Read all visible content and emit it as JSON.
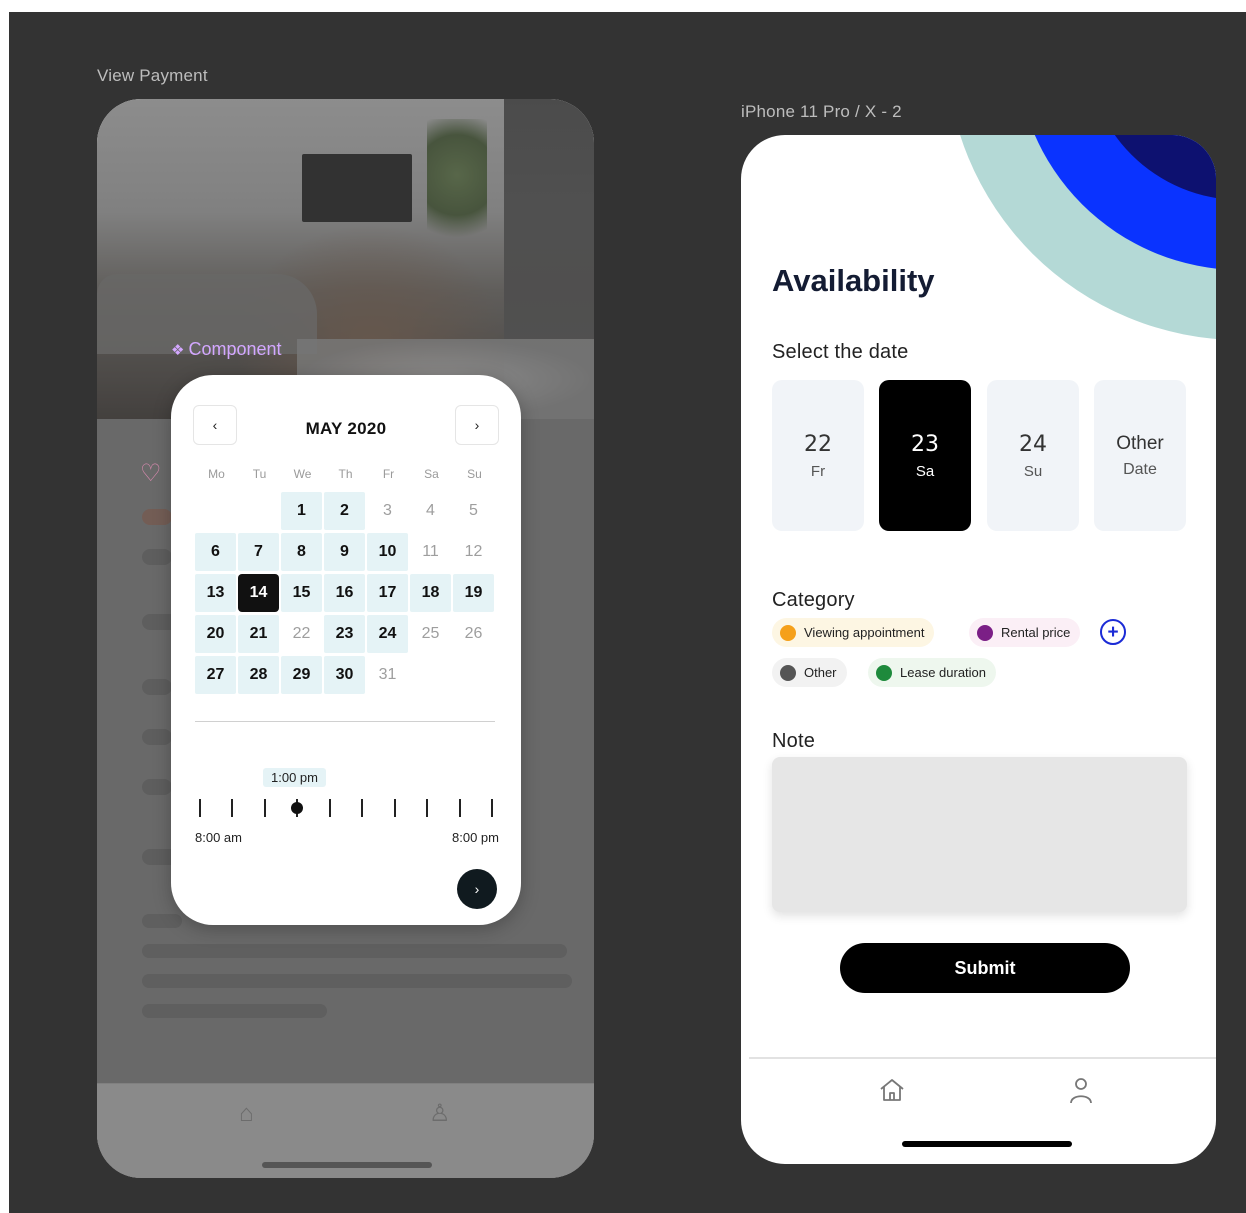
{
  "frames": {
    "left_label": "View Payment",
    "right_label": "iPhone 11 Pro / X - 2"
  },
  "component": {
    "label": "Component",
    "icon": "component-diamond-icon"
  },
  "calendar": {
    "month": "MAY 2020",
    "prev_label": "‹",
    "next_label": "›",
    "weekdays": [
      "Mo",
      "Tu",
      "We",
      "Th",
      "Fr",
      "Sa",
      "Su"
    ],
    "days": [
      {
        "label": "",
        "state": "empty"
      },
      {
        "label": "",
        "state": "empty"
      },
      {
        "label": "1",
        "state": "avail"
      },
      {
        "label": "2",
        "state": "avail"
      },
      {
        "label": "3",
        "state": "muted"
      },
      {
        "label": "4",
        "state": "muted"
      },
      {
        "label": "5",
        "state": "muted"
      },
      {
        "label": "6",
        "state": "avail"
      },
      {
        "label": "7",
        "state": "avail"
      },
      {
        "label": "8",
        "state": "avail"
      },
      {
        "label": "9",
        "state": "avail"
      },
      {
        "label": "10",
        "state": "avail"
      },
      {
        "label": "11",
        "state": "muted"
      },
      {
        "label": "12",
        "state": "muted"
      },
      {
        "label": "13",
        "state": "avail"
      },
      {
        "label": "14",
        "state": "selected"
      },
      {
        "label": "15",
        "state": "avail"
      },
      {
        "label": "16",
        "state": "avail"
      },
      {
        "label": "17",
        "state": "avail"
      },
      {
        "label": "18",
        "state": "avail"
      },
      {
        "label": "19",
        "state": "avail"
      },
      {
        "label": "20",
        "state": "avail"
      },
      {
        "label": "21",
        "state": "avail"
      },
      {
        "label": "22",
        "state": "muted"
      },
      {
        "label": "23",
        "state": "avail"
      },
      {
        "label": "24",
        "state": "avail"
      },
      {
        "label": "25",
        "state": "muted"
      },
      {
        "label": "26",
        "state": "muted"
      },
      {
        "label": "27",
        "state": "avail"
      },
      {
        "label": "28",
        "state": "avail"
      },
      {
        "label": "29",
        "state": "avail"
      },
      {
        "label": "30",
        "state": "avail"
      },
      {
        "label": "31",
        "state": "muted"
      }
    ],
    "time_selected": "1:00 pm",
    "time_start": "8:00 am",
    "time_end": "8:00 pm",
    "tick_count": 10,
    "knob_tick_index": 3,
    "next_button": "›"
  },
  "availability": {
    "title": "Availability",
    "select_date_label": "Select the date",
    "dates": [
      {
        "num": "22",
        "dow": "Fr",
        "active": false
      },
      {
        "num": "23",
        "dow": "Sa",
        "active": true
      },
      {
        "num": "24",
        "dow": "Su",
        "active": false
      }
    ],
    "other_date": {
      "top": "Other",
      "bottom": "Date"
    },
    "category_label": "Category",
    "categories": [
      {
        "label": "Viewing appointment",
        "dot_color": "#f5a01a",
        "bg": "#fdf6e3"
      },
      {
        "label": "Rental price",
        "dot_color": "#7b1f86",
        "bg": "#fbeff6"
      },
      {
        "label": "Other",
        "dot_color": "#555555",
        "bg": "#f2f2f2"
      },
      {
        "label": "Lease duration",
        "dot_color": "#1e8a3c",
        "bg": "#eef7ee"
      }
    ],
    "add_category_label": "+",
    "note_label": "Note",
    "note_value": "",
    "submit_label": "Submit"
  },
  "colors": {
    "deco_teal": "#b4d9d6",
    "deco_blue": "#0a33ff",
    "deco_navy": "#0d1170",
    "accent_blue": "#1b2bd6",
    "calendar_avail_bg": "#e5f3f6"
  },
  "tabbar": {
    "home_icon": "home-icon",
    "profile_icon": "user-icon"
  }
}
